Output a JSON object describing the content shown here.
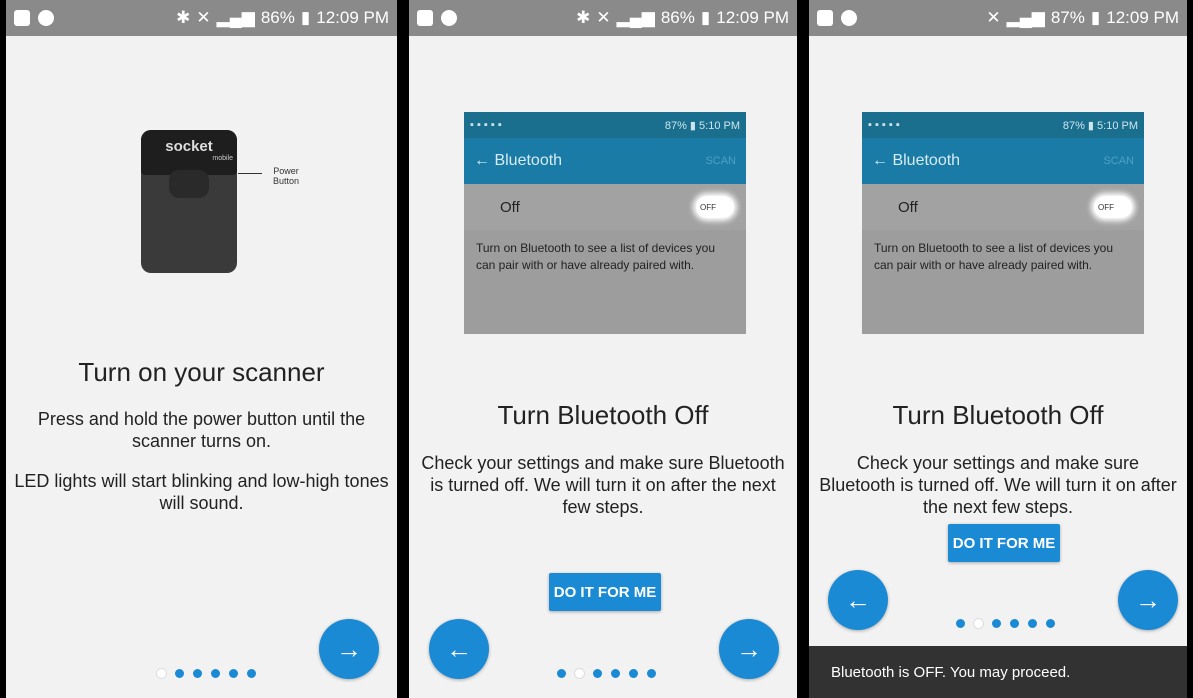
{
  "panels": [
    {
      "status": {
        "battery": "86%",
        "time": "12:09 PM"
      },
      "scanner": {
        "brand": "socket",
        "sub": "mobile",
        "power_label_1": "Power",
        "power_label_2": "Button"
      },
      "title": "Turn on your scanner",
      "desc1": "Press and hold the power button until the scanner turns on.",
      "desc2": "LED lights will start blinking and low-high tones will sound.",
      "next_icon": "arrow-right-icon",
      "dots_active_index": 0
    },
    {
      "status": {
        "battery": "86%",
        "time": "12:09 PM"
      },
      "shot": {
        "status_right": "87% ▮ 5:10 PM",
        "header": "← Bluetooth",
        "scan": "SCAN",
        "off": "Off",
        "toggle": "OFF",
        "text": "Turn on Bluetooth to see a list of devices you can pair with or have already paired with."
      },
      "title": "Turn Bluetooth Off",
      "desc": "Check your settings and make sure Bluetooth is turned off. We will turn it on after the next few steps.",
      "do_it": "DO IT FOR ME",
      "dots_active_index": 1
    },
    {
      "status": {
        "battery": "87%",
        "time": "12:09 PM"
      },
      "shot": {
        "status_right": "87% ▮ 5:10 PM",
        "header": "← Bluetooth",
        "scan": "SCAN",
        "off": "Off",
        "toggle": "OFF",
        "text": "Turn on Bluetooth to see a list of devices you can pair with or have already paired with."
      },
      "title": "Turn Bluetooth Off",
      "desc": "Check your settings and make sure Bluetooth is turned off. We will turn it on after the next few steps.",
      "do_it": "DO IT FOR ME",
      "snackbar": "Bluetooth is OFF. You may proceed.",
      "dots_active_index": 1
    }
  ],
  "colors": {
    "accent": "#1a8ad4",
    "status_bar": "#8a8a8a",
    "snackbar": "#323232"
  }
}
